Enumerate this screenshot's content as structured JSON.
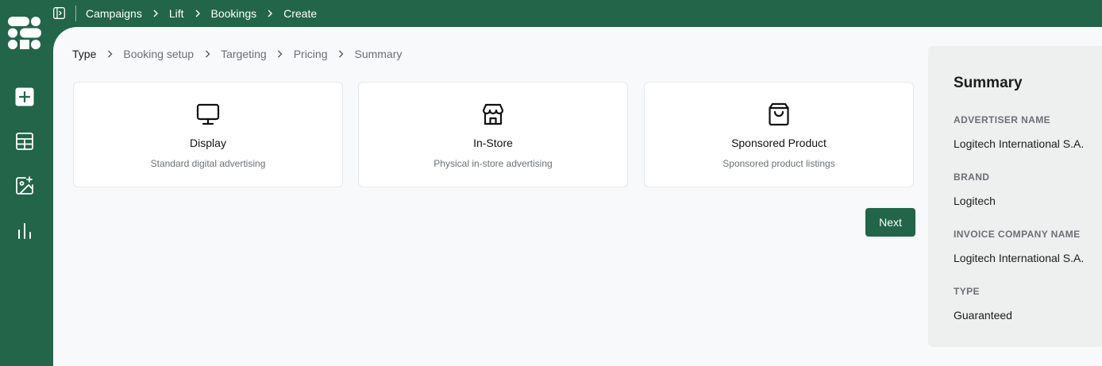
{
  "topbar": {
    "breadcrumbs": [
      "Campaigns",
      "Lift",
      "Bookings",
      "Create"
    ]
  },
  "steps": [
    "Type",
    "Booking setup",
    "Targeting",
    "Pricing",
    "Summary"
  ],
  "cards": [
    {
      "title": "Display",
      "subtitle": "Standard digital advertising",
      "icon": "monitor-icon"
    },
    {
      "title": "In-Store",
      "subtitle": "Physical in-store advertising",
      "icon": "store-icon"
    },
    {
      "title": "Sponsored Product",
      "subtitle": "Sponsored product listings",
      "icon": "shopping-bag-icon"
    }
  ],
  "actions": {
    "next_label": "Next"
  },
  "summary": {
    "title": "Summary",
    "fields": [
      {
        "label": "ADVERTISER NAME",
        "value": "Logitech International S.A."
      },
      {
        "label": "BRAND",
        "value": "Logitech"
      },
      {
        "label": "INVOICE COMPANY NAME",
        "value": "Logitech International S.A."
      },
      {
        "label": "TYPE",
        "value": "Guaranteed"
      }
    ]
  },
  "colors": {
    "brand": "#226549",
    "background": "#f8f9fa",
    "panel": "#eeefef"
  }
}
